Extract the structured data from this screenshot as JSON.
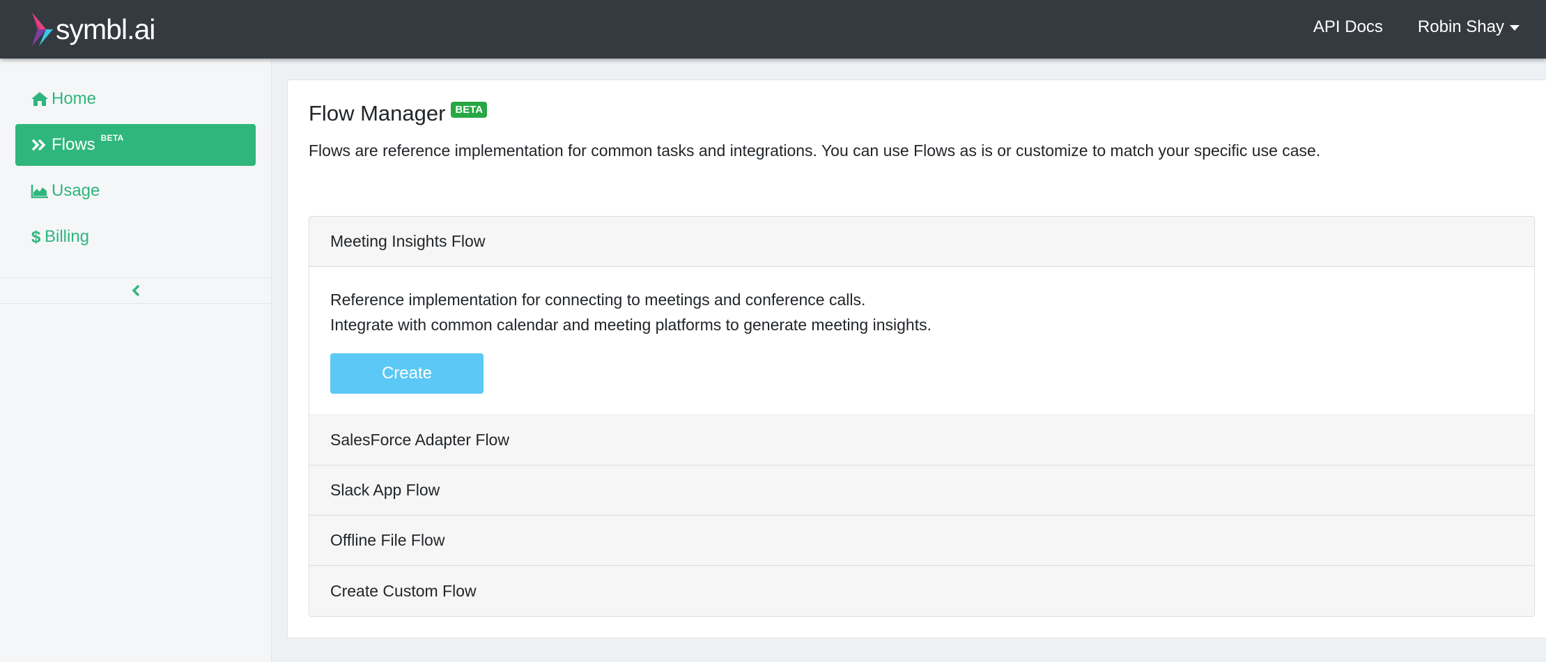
{
  "navbar": {
    "brand": "symbl.ai",
    "links": [
      {
        "label": "API Docs"
      },
      {
        "label": "Robin Shay"
      }
    ]
  },
  "sidebar": {
    "items": [
      {
        "label": "Home",
        "icon": "home-icon"
      },
      {
        "label": "Flows",
        "icon": "double-chevron-right-icon",
        "badge": "BETA",
        "active": true
      },
      {
        "label": "Usage",
        "icon": "area-chart-icon"
      },
      {
        "label": "Billing",
        "icon": "dollar-icon"
      }
    ],
    "collapse_icon": "chevron-left-icon"
  },
  "main": {
    "title": "Flow Manager",
    "title_badge": "BETA",
    "description": "Flows are reference implementation for common tasks and integrations. You can use Flows as is or customize to match your specific use case.",
    "accordion": {
      "expanded": {
        "title": "Meeting Insights Flow",
        "lines": [
          "Reference implementation for connecting to meetings and conference calls.",
          "Integrate with common calendar and meeting platforms to generate meeting insights."
        ],
        "button": "Create"
      },
      "items": [
        {
          "title": "SalesForce Adapter Flow"
        },
        {
          "title": "Slack App Flow"
        },
        {
          "title": "Offline File Flow"
        },
        {
          "title": "Create Custom Flow"
        }
      ]
    }
  },
  "colors": {
    "navbar": "#343a40",
    "accent_green": "#2fb67c",
    "badge_green": "#28a745",
    "create_button": "#5bc8f5",
    "sidebar_bg": "#f4f6f8"
  }
}
